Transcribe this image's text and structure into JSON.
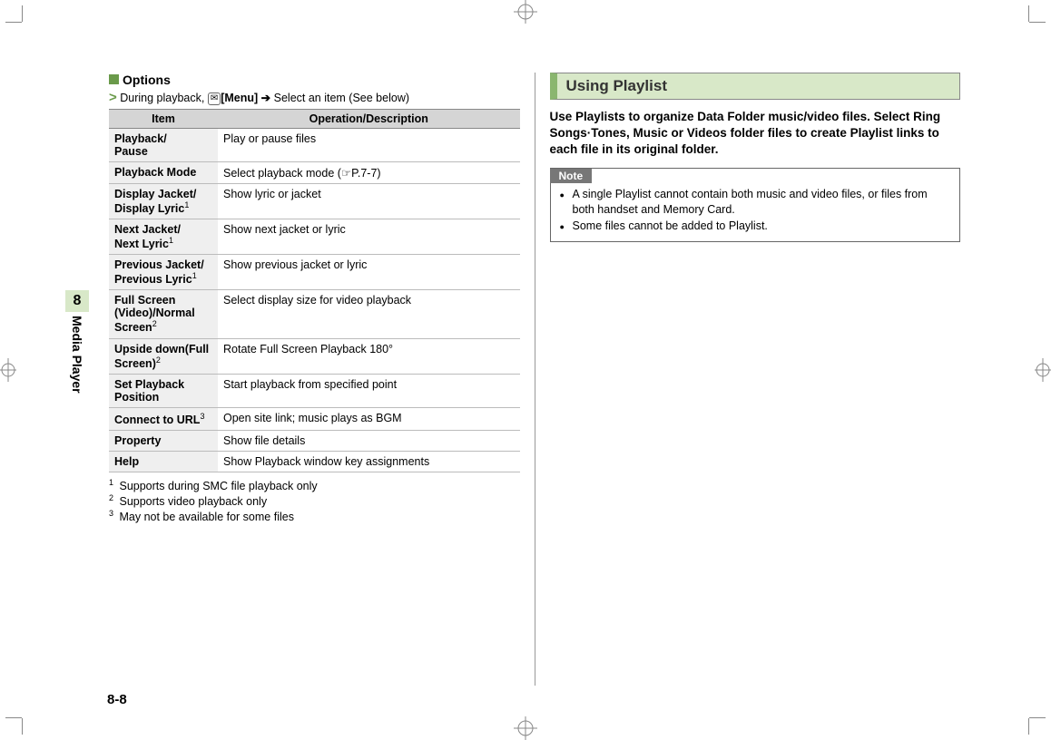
{
  "side": {
    "chapter_num": "8",
    "chapter_title": "Media Player"
  },
  "left": {
    "options_label": "Options",
    "instruction_prefix": "During playback, ",
    "menu_label": "[Menu]",
    "instruction_suffix": " Select an item (See below)",
    "th_item": "Item",
    "th_desc": "Operation/Description",
    "rows": [
      {
        "item": "Playback/\nPause",
        "sup": "",
        "desc": "Play or pause files"
      },
      {
        "item": "Playback Mode",
        "sup": "",
        "desc": "Select playback mode (☞P.7-7)"
      },
      {
        "item": "Display Jacket/\nDisplay Lyric",
        "sup": "1",
        "desc": "Show lyric or jacket"
      },
      {
        "item": "Next Jacket/\nNext Lyric",
        "sup": "1",
        "desc": "Show next jacket or lyric"
      },
      {
        "item": "Previous Jacket/\nPrevious Lyric",
        "sup": "1",
        "desc": "Show previous jacket or lyric"
      },
      {
        "item": "Full Screen (Video)/Normal Screen",
        "sup": "2",
        "desc": "Select display size for video playback"
      },
      {
        "item": "Upside down(Full Screen)",
        "sup": "2",
        "desc": "Rotate Full Screen Playback 180°"
      },
      {
        "item": "Set Playback Position",
        "sup": "",
        "desc": "Start playback from specified point"
      },
      {
        "item": "Connect to URL",
        "sup": "3",
        "desc": "Open site link; music plays as BGM"
      },
      {
        "item": "Property",
        "sup": "",
        "desc": "Show file details"
      },
      {
        "item": "Help",
        "sup": "",
        "desc": "Show Playback window key assignments"
      }
    ],
    "footnotes": [
      {
        "n": "1",
        "t": "Supports during SMC file playback only"
      },
      {
        "n": "2",
        "t": "Supports video playback only"
      },
      {
        "n": "3",
        "t": "May not be available for some files"
      }
    ]
  },
  "right": {
    "heading": "Using Playlist",
    "intro": "Use Playlists to organize Data Folder music/video files. Select Ring Songs·Tones, Music or Videos folder files to create Playlist links to each file in its original folder.",
    "note_label": "Note",
    "notes": [
      "A single Playlist cannot contain both music and video files, or files from both handset and Memory Card.",
      "Some files cannot be added to Playlist."
    ]
  },
  "page_number": "8-8"
}
